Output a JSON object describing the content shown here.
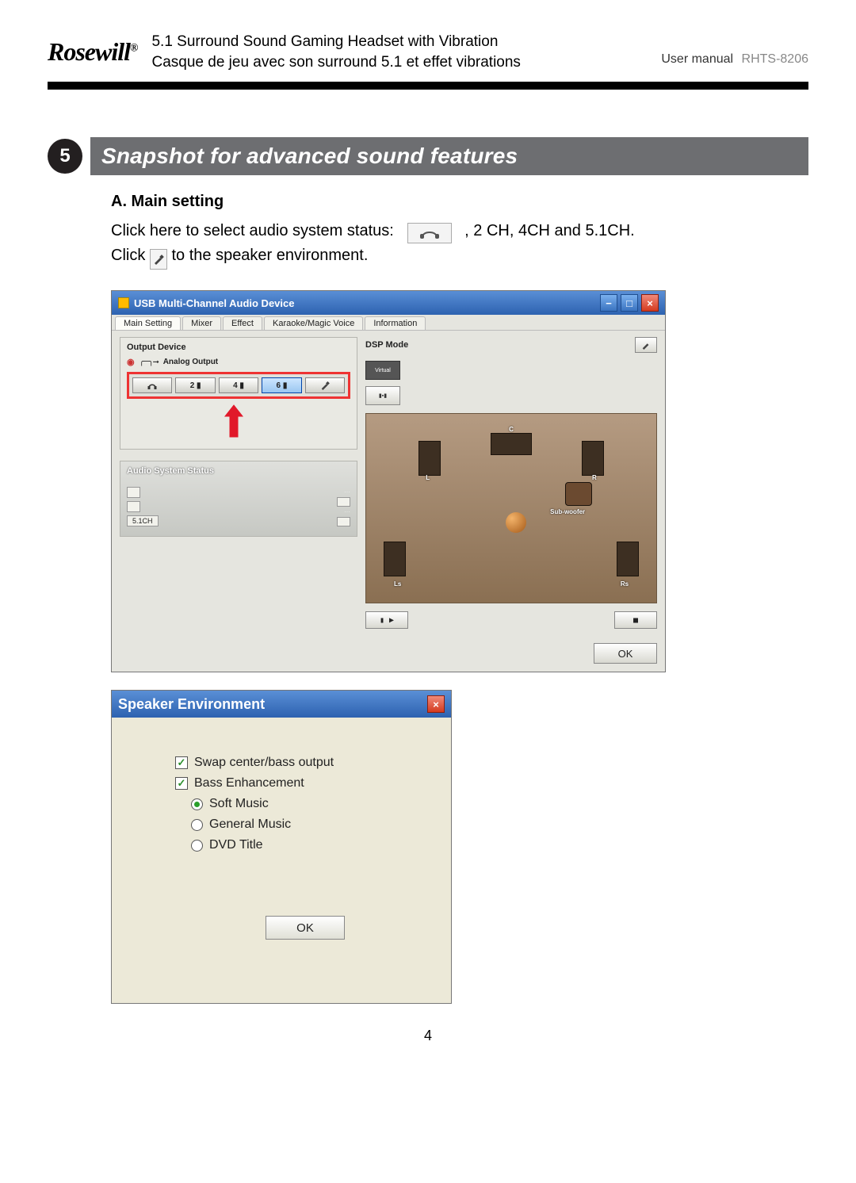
{
  "brand": "Rosewill",
  "brand_reg": "®",
  "header_line1": "5.1 Surround Sound Gaming Headset with Vibration",
  "header_line2": "Casque de jeu avec son surround 5.1 et effet vibrations",
  "header_right_label": "User manual",
  "header_right_model": "RHTS-8206",
  "section_number": "5",
  "section_title": "Snapshot for advanced sound features",
  "subsection_a": "A. Main setting",
  "body_line1a": "Click here to select audio system status:",
  "body_line1b": ", 2 CH, 4CH and 5.1CH.",
  "body_line2a": "Click",
  "body_line2b": "to the speaker environment.",
  "win1": {
    "title": "USB Multi-Channel Audio Device",
    "tabs": [
      "Main Setting",
      "Mixer",
      "Effect",
      "Karaoke/Magic Voice",
      "Information"
    ],
    "output_device_label": "Output Device",
    "analog_output_label": "Analog Output",
    "channel_buttons": {
      "hp": "",
      "ch2": "2",
      "ch4": "4",
      "ch6": "6"
    },
    "dsp_mode_label": "DSP Mode",
    "dsp_virtual_label": "Virtual",
    "audio_status_label": "Audio System Status",
    "audio_status_chip": "5.1CH",
    "room_labels": {
      "L": "L",
      "R": "R",
      "C": "C",
      "Ls": "Ls",
      "Rs": "Rs",
      "Sub": "Sub-woofer"
    },
    "media_play": "▮ ▶",
    "media_stop": "■",
    "ok": "OK"
  },
  "win2": {
    "title": "Speaker Environment",
    "swap": "Swap center/bass output",
    "bass": "Bass Enhancement",
    "opt_soft": "Soft Music",
    "opt_general": "General Music",
    "opt_dvd": "DVD Title",
    "ok": "OK"
  },
  "page_number": "4"
}
